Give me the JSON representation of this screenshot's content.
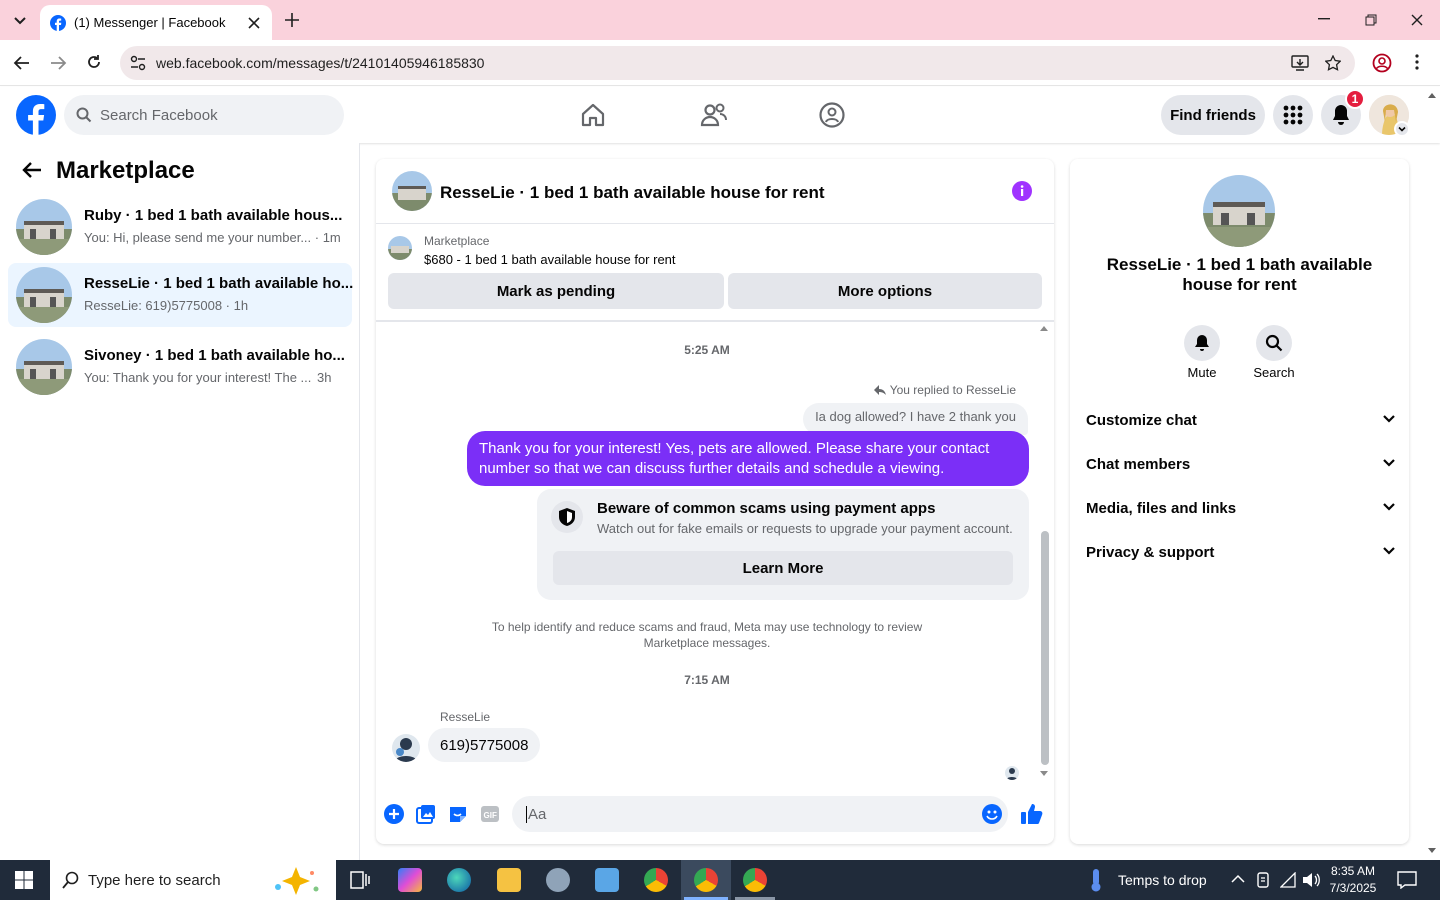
{
  "browser": {
    "tab_title": "(1) Messenger | Facebook",
    "url": "web.facebook.com/messages/t/24101405946185830"
  },
  "fb_header": {
    "search_placeholder": "Search Facebook",
    "find_friends": "Find friends",
    "notification_count": "1"
  },
  "left_panel": {
    "title": "Marketplace",
    "conversations": [
      {
        "title": "Ruby · 1 bed 1 bath available hous...",
        "preview": "You: Hi, please send me your number... · 1m",
        "selected": false
      },
      {
        "title": "ResseLie · 1 bed 1 bath available ho...",
        "preview": "ResseLie: 619)5775008 · 1h",
        "selected": true
      },
      {
        "title": "Sivoney · 1 bed 1 bath available ho...",
        "preview": "You: Thank you for your interest! The ...",
        "time": "3h",
        "selected": false
      }
    ]
  },
  "chat": {
    "header_title": "ResseLie · 1 bed 1 bath available house for rent",
    "listing_label": "Marketplace",
    "listing_detail": "$680 - 1 bed 1 bath available house for rent",
    "mark_pending": "Mark as pending",
    "more_options": "More options",
    "time1": "5:25 AM",
    "replied_to": "You replied to ResseLie",
    "quoted": "Ia dog allowed? I have 2 thank you",
    "my_message": "Thank you for your interest! Yes, pets are allowed. Please share your contact number so that we can discuss further details and schedule a viewing.",
    "scam_title": "Beware of common scams using payment apps",
    "scam_body": "Watch out for fake emails or requests to upgrade your payment account.",
    "learn_more": "Learn More",
    "notice": "To help identify and reduce scams and fraud, Meta may use technology to review Marketplace messages.",
    "time2": "7:15 AM",
    "sender": "ResseLie",
    "their_message": "619)5775008",
    "composer_placeholder": "Aa",
    "accent": "#7b2ff7"
  },
  "right_panel": {
    "name": "ResseLie · 1 bed 1 bath available house for rent",
    "mute": "Mute",
    "search": "Search",
    "sections": [
      "Customize chat",
      "Chat members",
      "Media, files and links",
      "Privacy & support"
    ]
  },
  "taskbar": {
    "search_placeholder": "Type here to search",
    "weather": "Temps to drop",
    "time": "8:35 AM",
    "date": "7/3/2025"
  }
}
